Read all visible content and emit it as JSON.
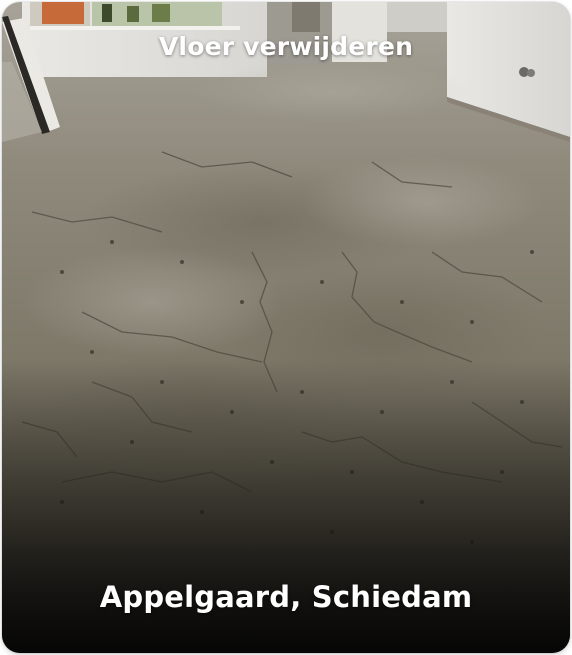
{
  "card": {
    "service_title": "Vloer verwijderen",
    "location": "Appelgaard, Schiedam"
  },
  "photo": {
    "subject": "concrete-floor-photo"
  }
}
